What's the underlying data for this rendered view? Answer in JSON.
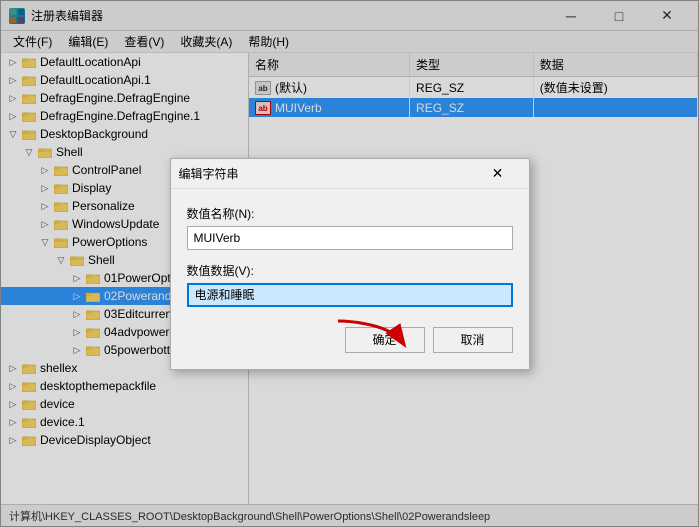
{
  "window": {
    "title": "注册表编辑器",
    "title_icon": "regedit"
  },
  "title_bar_buttons": {
    "minimize": "─",
    "maximize": "□",
    "close": "✕"
  },
  "menu_bar": {
    "items": [
      "文件(F)",
      "编辑(E)",
      "查看(V)",
      "收藏夹(A)",
      "帮助(H)"
    ]
  },
  "tree": {
    "nodes": [
      {
        "id": "DefaultLocationApi",
        "label": "DefaultLocationApi",
        "level": 0,
        "expanded": false,
        "selected": false
      },
      {
        "id": "DefaultLocationApi1",
        "label": "DefaultLocationApi.1",
        "level": 0,
        "expanded": false,
        "selected": false
      },
      {
        "id": "DefragEngine",
        "label": "DefragEngine.DefragEngine",
        "level": 0,
        "expanded": false,
        "selected": false
      },
      {
        "id": "DefragEngine1",
        "label": "DefragEngine.DefragEngine.1",
        "level": 0,
        "expanded": false,
        "selected": false
      },
      {
        "id": "DesktopBackground",
        "label": "DesktopBackground",
        "level": 0,
        "expanded": true,
        "selected": false
      },
      {
        "id": "Shell",
        "label": "Shell",
        "level": 1,
        "expanded": true,
        "selected": false
      },
      {
        "id": "ControlPanel",
        "label": "ControlPanel",
        "level": 2,
        "expanded": false,
        "selected": false
      },
      {
        "id": "Display",
        "label": "Display",
        "level": 2,
        "expanded": false,
        "selected": false
      },
      {
        "id": "Personalize",
        "label": "Personalize",
        "level": 2,
        "expanded": false,
        "selected": false
      },
      {
        "id": "WindowsUpdate",
        "label": "WindowsUpdate",
        "level": 2,
        "expanded": false,
        "selected": false
      },
      {
        "id": "PowerOptions",
        "label": "PowerOptions",
        "level": 2,
        "expanded": true,
        "selected": false
      },
      {
        "id": "Shell2",
        "label": "Shell",
        "level": 3,
        "expanded": true,
        "selected": false
      },
      {
        "id": "01PowerOptions",
        "label": "01PowerOptions",
        "level": 4,
        "expanded": false,
        "selected": false
      },
      {
        "id": "02Powerandsleep",
        "label": "02Powerandsleep",
        "level": 4,
        "expanded": false,
        "selected": true
      },
      {
        "id": "03Editcurrentoptions",
        "label": "03Editcurrentoptions",
        "level": 4,
        "expanded": false,
        "selected": false
      },
      {
        "id": "04advpoweroptions",
        "label": "04advpoweroptions",
        "level": 4,
        "expanded": false,
        "selected": false
      },
      {
        "id": "05powerbottons",
        "label": "05powerbottons",
        "level": 4,
        "expanded": false,
        "selected": false
      },
      {
        "id": "shellex",
        "label": "shellex",
        "level": 0,
        "expanded": false,
        "selected": false
      },
      {
        "id": "desktopthemepackfile",
        "label": "desktopthemepackfile",
        "level": 0,
        "expanded": false,
        "selected": false
      },
      {
        "id": "device",
        "label": "device",
        "level": 0,
        "expanded": false,
        "selected": false
      },
      {
        "id": "device1",
        "label": "device.1",
        "level": 0,
        "expanded": false,
        "selected": false
      },
      {
        "id": "DeviceDisplayObject",
        "label": "DeviceDisplayObject",
        "level": 0,
        "expanded": false,
        "selected": false
      }
    ]
  },
  "registry_table": {
    "columns": [
      "名称",
      "类型",
      "数据"
    ],
    "rows": [
      {
        "name": "(默认)",
        "type": "REG_SZ",
        "data": "(数值未设置)",
        "selected": false,
        "icon": "ab"
      },
      {
        "name": "MUIVerb",
        "type": "REG_SZ",
        "data": "",
        "selected": true,
        "icon": "ab-red"
      }
    ]
  },
  "dialog": {
    "title": "编辑字符串",
    "close_btn": "✕",
    "field_name_label": "数值名称(N):",
    "field_name_value": "MUIVerb",
    "field_data_label": "数值数据(V):",
    "field_data_value": "电源和睡眠",
    "btn_ok": "确定",
    "btn_cancel": "取消"
  },
  "status_bar": {
    "text": "计算机\\HKEY_CLASSES_ROOT\\DesktopBackground\\Shell\\PowerOptions\\Shell\\02Powerandsleep"
  }
}
